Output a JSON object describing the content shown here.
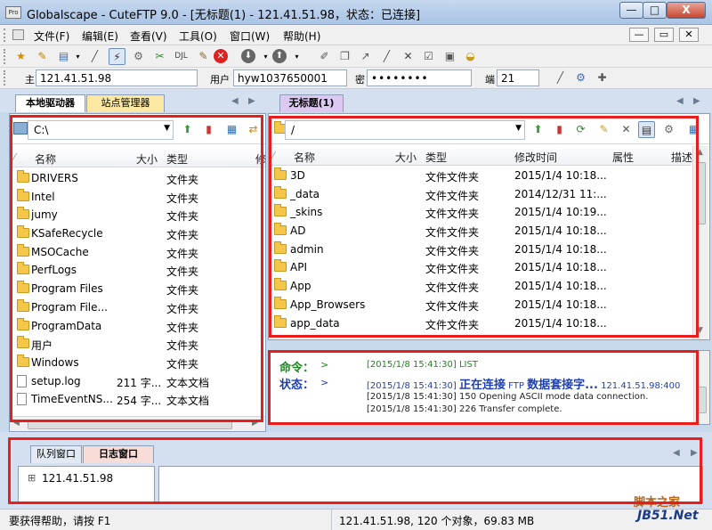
{
  "window": {
    "app_icon_text": "Pro",
    "title": "Globalscape - CuteFTP 9.0 - [无标题(1) - 121.41.51.98，状态：已连接]",
    "min_glyph": "—",
    "max_glyph": "□",
    "close_glyph": "X"
  },
  "menu": {
    "items": [
      "文件(F)",
      "编辑(E)",
      "查看(V)",
      "工具(O)",
      "窗口(W)",
      "帮助(H)"
    ],
    "mdi_buttons": [
      "—",
      "▭",
      "✕"
    ]
  },
  "quick_connect": {
    "host_label": "主",
    "host_value": "121.41.51.98",
    "user_label": "用户",
    "user_value": "hyw1037650001",
    "pass_label": "密",
    "pass_value": "••••••••",
    "port_label": "端",
    "port_value": "21"
  },
  "tabs": {
    "local": "本地驱动器",
    "sites": "站点管理器",
    "remote": "无标题(1)"
  },
  "local": {
    "path": "C:\\",
    "columns": [
      "名称",
      "大小",
      "类型",
      "修"
    ],
    "rows": [
      {
        "name": "DRIVERS",
        "size": "",
        "type": "文件夹",
        "kind": "folder"
      },
      {
        "name": "Intel",
        "size": "",
        "type": "文件夹",
        "kind": "folder"
      },
      {
        "name": "jumy",
        "size": "",
        "type": "文件夹",
        "kind": "folder"
      },
      {
        "name": "KSafeRecycle",
        "size": "",
        "type": "文件夹",
        "kind": "folder"
      },
      {
        "name": "MSOCache",
        "size": "",
        "type": "文件夹",
        "kind": "folder"
      },
      {
        "name": "PerfLogs",
        "size": "",
        "type": "文件夹",
        "kind": "folder"
      },
      {
        "name": "Program Files",
        "size": "",
        "type": "文件夹",
        "kind": "folder"
      },
      {
        "name": "Program File...",
        "size": "",
        "type": "文件夹",
        "kind": "folder"
      },
      {
        "name": "ProgramData",
        "size": "",
        "type": "文件夹",
        "kind": "folder"
      },
      {
        "name": "用户",
        "size": "",
        "type": "文件夹",
        "kind": "folder"
      },
      {
        "name": "Windows",
        "size": "",
        "type": "文件夹",
        "kind": "folder"
      },
      {
        "name": "setup.log",
        "size": "211 字...",
        "type": "文本文档",
        "kind": "file"
      },
      {
        "name": "TimeEventNS...",
        "size": "254 字...",
        "type": "文本文档",
        "kind": "file"
      }
    ]
  },
  "remote": {
    "path": "/",
    "columns": [
      "名称",
      "大小",
      "类型",
      "修改时间",
      "属性",
      "描述"
    ],
    "rows": [
      {
        "name": "3D",
        "type": "文件文件夹",
        "modified": "2015/1/4 10:18..."
      },
      {
        "name": "_data",
        "type": "文件文件夹",
        "modified": "2014/12/31 11:..."
      },
      {
        "name": "_skins",
        "type": "文件文件夹",
        "modified": "2015/1/4 10:19..."
      },
      {
        "name": "AD",
        "type": "文件文件夹",
        "modified": "2015/1/4 10:18..."
      },
      {
        "name": "admin",
        "type": "文件文件夹",
        "modified": "2015/1/4 10:18..."
      },
      {
        "name": "API",
        "type": "文件文件夹",
        "modified": "2015/1/4 10:18..."
      },
      {
        "name": "App",
        "type": "文件文件夹",
        "modified": "2015/1/4 10:18..."
      },
      {
        "name": "App_Browsers",
        "type": "文件文件夹",
        "modified": "2015/1/4 10:18..."
      },
      {
        "name": "app_data",
        "type": "文件文件夹",
        "modified": "2015/1/4 10:18..."
      }
    ]
  },
  "log": {
    "command_label": "命令：",
    "command_arrow": ">",
    "command_text": "[2015/1/8 15:41:30] LIST",
    "status_label": "状态：",
    "status_arrow": ">",
    "status_prefix": "[2015/1/8 15:41:30] ",
    "status_big1": "正在连接",
    "status_small": " FTP ",
    "status_big2": "数据套接字...",
    "status_tail": " 121.41.51.98:400",
    "line3": "[2015/1/8 15:41:30] 150 Opening ASCII mode data connection.",
    "line4": "[2015/1/8 15:41:30] 226 Transfer complete."
  },
  "bottom": {
    "tab_queue": "队列窗口",
    "tab_log": "日志窗口",
    "tree_expand": "⊞",
    "tree_item": "121.41.51.98"
  },
  "statusbar": {
    "help": "要获得帮助，请按 F1",
    "info": "121.41.51.98, 120 个对象，69.83 MB"
  },
  "watermark": {
    "line1": "脚本之家",
    "line2": "JB51.Net"
  }
}
